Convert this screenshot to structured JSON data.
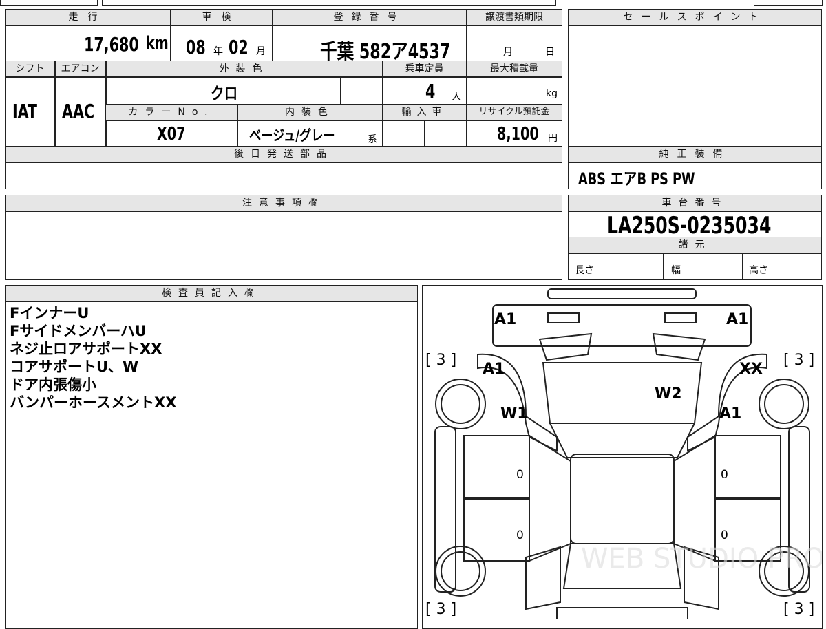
{
  "header": {
    "mileage_label": "走行",
    "mileage_value": "17,680",
    "mileage_unit": "km",
    "inspection_label": "車検",
    "inspection_year": "08",
    "inspection_year_unit": "年",
    "inspection_month": "02",
    "inspection_month_unit": "月",
    "registration_label": "登録番号",
    "registration_value": "千葉 582ア4537",
    "transfer_deadline_label": "譲渡書類期限",
    "transfer_month_unit": "月",
    "transfer_day_unit": "日",
    "sales_point_label": "セールスポイント"
  },
  "specs": {
    "shift_label": "シフト",
    "shift_value": "IAT",
    "ac_label": "エアコン",
    "ac_value": "AAC",
    "exterior_color_label": "外装色",
    "exterior_color_value": "クロ",
    "capacity_label": "乗車定員",
    "capacity_value": "4",
    "capacity_unit": "人",
    "max_load_label": "最大積載量",
    "max_load_unit": "kg",
    "color_no_label": "カラーNo.",
    "color_no_value": "X07",
    "interior_color_label": "内装色",
    "interior_color_value": "ベージュ/グレー",
    "interior_color_suffix": "系",
    "import_label": "輸入車",
    "recycle_label": "リサイクル預託金",
    "recycle_value": "8,100",
    "recycle_unit": "円"
  },
  "later_parts_label": "後日発送部品",
  "genuine_equipment": {
    "label": "純正装備",
    "value": "ABS エアB PS PW"
  },
  "cautions_label": "注意事項欄",
  "chassis": {
    "label": "車台番号",
    "value": "LA250S-0235034",
    "specs_label": "諸元",
    "length_label": "長さ",
    "width_label": "幅",
    "height_label": "高さ"
  },
  "inspector": {
    "label": "検査員記入欄",
    "notes": [
      "FインナーU",
      "FサイドメンバーハU",
      "ネジ止ロアサポートXX",
      "コアサポートU、W",
      "ドア内張傷小",
      "バンパーホースメントXX"
    ]
  },
  "diagram_marks": {
    "front_left_corner": "A1",
    "front_right_corner": "A1",
    "left_fender": "A1",
    "right_fender": "XX",
    "hood": "W2",
    "left_front": "W1",
    "right_front": "A1",
    "tire_fl": "[ 3 ]",
    "tire_fr": "[ 3 ]",
    "tire_rl": "[ 3 ]",
    "tire_rr": "[ 3 ]",
    "left_front_door": "0",
    "left_rear_door": "0",
    "right_front_door": "0",
    "right_rear_door": "0"
  },
  "watermark": "WEB STUDIO PRO"
}
